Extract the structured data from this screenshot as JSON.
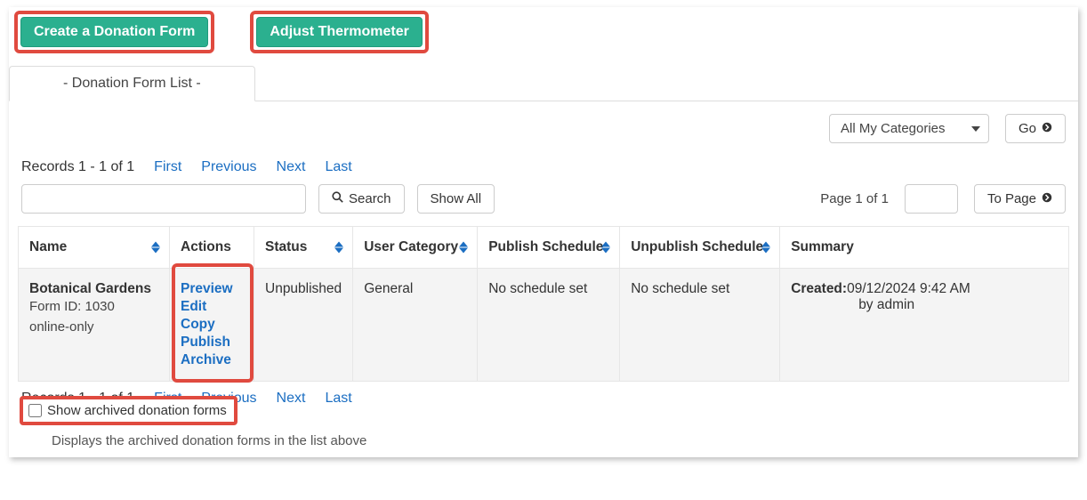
{
  "buttons": {
    "create_form": "Create a Donation Form",
    "adjust_thermo": "Adjust Thermometer",
    "go": "Go",
    "search": "Search",
    "show_all": "Show All",
    "to_page": "To Page"
  },
  "tab": {
    "label": "- Donation Form List -"
  },
  "filter": {
    "category_selected": "All My Categories"
  },
  "pager": {
    "records": "Records 1 - 1 of 1",
    "first": "First",
    "previous": "Previous",
    "next": "Next",
    "last": "Last",
    "page_info": "Page 1 of 1"
  },
  "table": {
    "headers": {
      "name": "Name",
      "actions": "Actions",
      "status": "Status",
      "user_category": "User Category",
      "publish_schedule": "Publish Schedule",
      "unpublish_schedule": "Unpublish Schedule",
      "summary": "Summary"
    },
    "row": {
      "name": "Botanical Gardens",
      "form_id_label": "Form ID: 1030",
      "online": "online-only",
      "actions": {
        "preview": "Preview",
        "edit": "Edit",
        "copy": "Copy",
        "publish": "Publish",
        "archive": "Archive"
      },
      "status": "Unpublished",
      "user_category": "General",
      "publish_schedule": "No schedule set",
      "unpublish_schedule": "No schedule set",
      "summary_label": "Created:",
      "summary_value": "09/12/2024 9:42 AM",
      "summary_by": "by admin"
    }
  },
  "archived": {
    "checkbox_label": "Show archived donation forms",
    "helper": "Displays the archived donation forms in the list above"
  }
}
